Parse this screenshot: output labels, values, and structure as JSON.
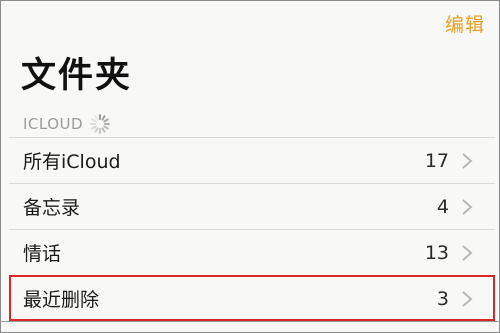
{
  "header": {
    "edit_label": "编辑",
    "title": "文件夹"
  },
  "section": {
    "name": "ICLOUD"
  },
  "folders": [
    {
      "label": "所有iCloud",
      "count": "17"
    },
    {
      "label": "备忘录",
      "count": "4"
    },
    {
      "label": "情话",
      "count": "13"
    },
    {
      "label": "最近删除",
      "count": "3",
      "highlighted": true
    }
  ],
  "colors": {
    "accent": "#e3a125",
    "highlight_border": "#d8262b",
    "section_text": "#9a9a9a"
  },
  "icons": {
    "loading": "loading-spinner-icon",
    "disclosure": "chevron-right-icon"
  }
}
